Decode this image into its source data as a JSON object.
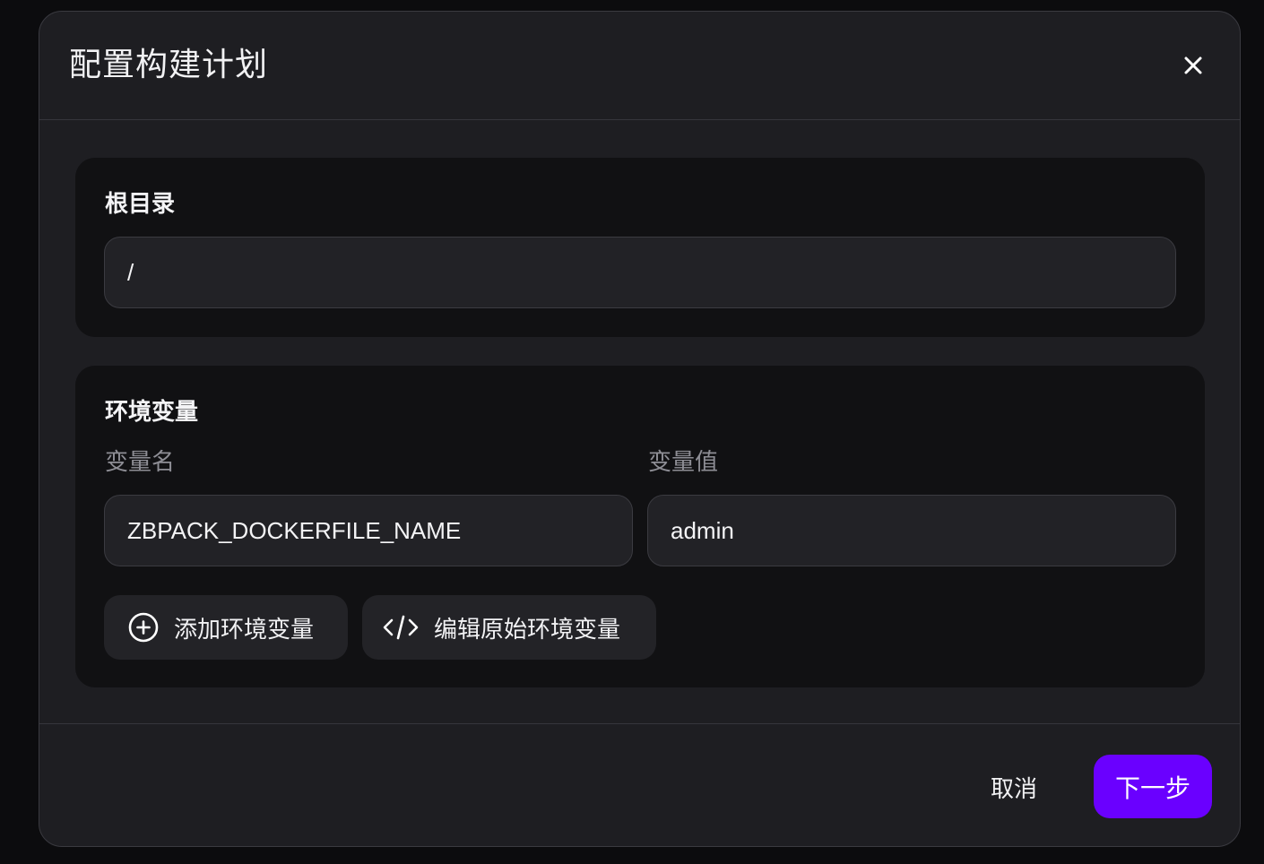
{
  "dialog": {
    "title": "配置构建计划",
    "close_icon": "close-icon"
  },
  "root_section": {
    "title": "根目录",
    "input_value": "/"
  },
  "env_section": {
    "title": "环境变量",
    "name_label": "变量名",
    "value_label": "变量值",
    "rows": [
      {
        "name": "ZBPACK_DOCKERFILE_NAME",
        "value": "admin"
      }
    ],
    "add_button": {
      "label": "添加环境变量",
      "icon": "plus-circle-icon"
    },
    "edit_raw_button": {
      "label": "编辑原始环境变量",
      "icon": "code-icon"
    }
  },
  "footer": {
    "cancel_label": "取消",
    "next_label": "下一步"
  },
  "colors": {
    "accent": "#6a00ff",
    "modal_bg": "#1e1e22",
    "section_bg": "#111113",
    "input_bg": "#222226"
  }
}
